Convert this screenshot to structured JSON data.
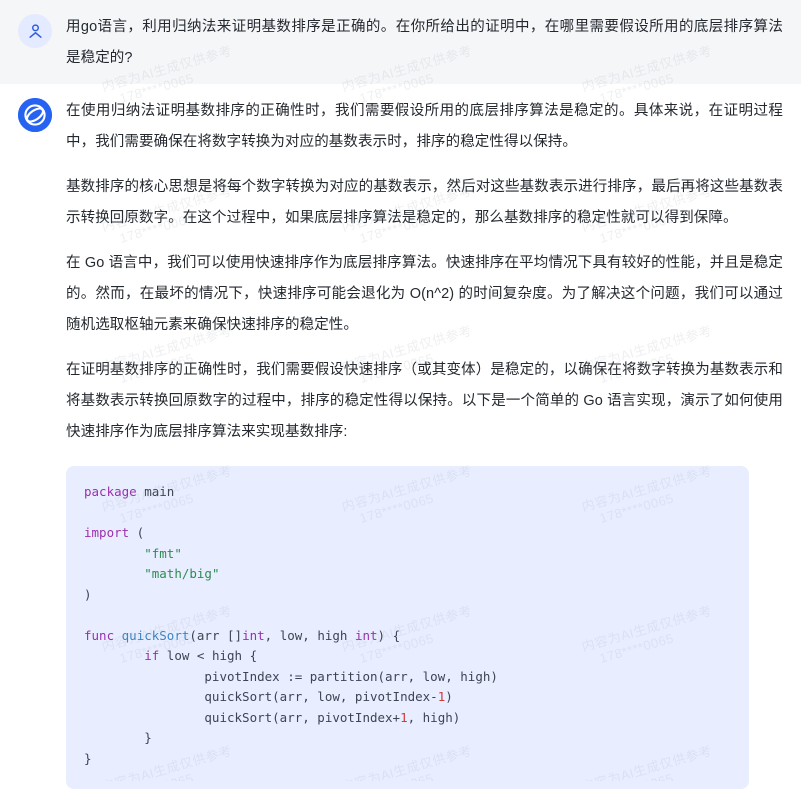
{
  "watermark": {
    "line1": "内容为AI生成仅供参考",
    "line2": "178****0065"
  },
  "conversation": {
    "user": {
      "avatar_icon": "user-person-icon",
      "avatar_bg": "#e4eaff",
      "message": "用go语言，利用归纳法来证明基数排序是正确的。在你所给出的证明中，在哪里需要假设所用的底层排序算法是稳定的?"
    },
    "assistant": {
      "avatar_icon": "assistant-logo-icon",
      "avatar_bg": "#2563f0",
      "paragraphs": [
        "在使用归纳法证明基数排序的正确性时，我们需要假设所用的底层排序算法是稳定的。具体来说，在证明过程中，我们需要确保在将数字转换为对应的基数表示时，排序的稳定性得以保持。",
        "基数排序的核心思想是将每个数字转换为对应的基数表示，然后对这些基数表示进行排序，最后再将这些基数表示转换回原数字。在这个过程中，如果底层排序算法是稳定的，那么基数排序的稳定性就可以得到保障。",
        "在 Go 语言中，我们可以使用快速排序作为底层排序算法。快速排序在平均情况下具有较好的性能，并且是稳定的。然而，在最坏的情况下，快速排序可能会退化为 O(n^2) 的时间复杂度。为了解决这个问题，我们可以通过随机选取枢轴元素来确保快速排序的稳定性。",
        "在证明基数排序的正确性时，我们需要假设快速排序（或其变体）是稳定的，以确保在将数字转换为基数表示和将基数表示转换回原数字的过程中，排序的稳定性得以保持。以下是一个简单的 Go 语言实现，演示了如何使用快速排序作为底层排序算法来实现基数排序:"
      ],
      "code_block": {
        "language": "go",
        "background": "#e8eeff",
        "lines": [
          [
            {
              "t": "package",
              "c": "k"
            },
            {
              "t": " main",
              "c": "p"
            }
          ],
          [],
          [
            {
              "t": "import",
              "c": "k"
            },
            {
              "t": " (",
              "c": "p"
            }
          ],
          [
            {
              "t": "        ",
              "c": "p"
            },
            {
              "t": "\"fmt\"",
              "c": "s"
            }
          ],
          [
            {
              "t": "        ",
              "c": "p"
            },
            {
              "t": "\"math/big\"",
              "c": "s"
            }
          ],
          [
            {
              "t": ")",
              "c": "p"
            }
          ],
          [],
          [
            {
              "t": "func",
              "c": "k"
            },
            {
              "t": " ",
              "c": "p"
            },
            {
              "t": "quickSort",
              "c": "fn"
            },
            {
              "t": "(arr []",
              "c": "p"
            },
            {
              "t": "int",
              "c": "k"
            },
            {
              "t": ", low, high ",
              "c": "p"
            },
            {
              "t": "int",
              "c": "k"
            },
            {
              "t": ") {",
              "c": "p"
            }
          ],
          [
            {
              "t": "        ",
              "c": "p"
            },
            {
              "t": "if",
              "c": "k"
            },
            {
              "t": " low < high {",
              "c": "p"
            }
          ],
          [
            {
              "t": "                pivotIndex := partition(arr, low, high)",
              "c": "p"
            }
          ],
          [
            {
              "t": "                quickSort(arr, low, pivotIndex-",
              "c": "p"
            },
            {
              "t": "1",
              "c": "n"
            },
            {
              "t": ")",
              "c": "p"
            }
          ],
          [
            {
              "t": "                quickSort(arr, pivotIndex+",
              "c": "p"
            },
            {
              "t": "1",
              "c": "n"
            },
            {
              "t": ", high)",
              "c": "p"
            }
          ],
          [
            {
              "t": "        }",
              "c": "p"
            }
          ],
          [
            {
              "t": "}",
              "c": "p"
            }
          ]
        ]
      }
    }
  }
}
